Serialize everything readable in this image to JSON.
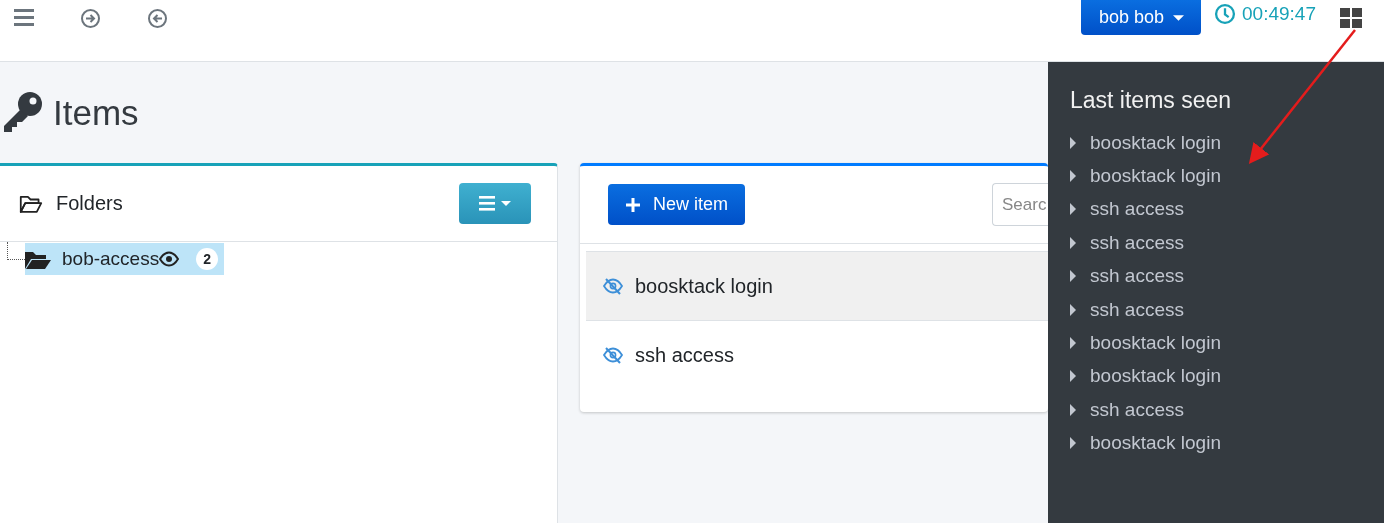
{
  "navbar": {
    "user_button": "bob bob",
    "timer": "00:49:47"
  },
  "page": {
    "title": "Items"
  },
  "folders": {
    "title": "Folders",
    "tree": [
      {
        "label": "bob-access",
        "count": "2",
        "selected": true
      }
    ]
  },
  "items": {
    "new_button": "New item",
    "search": {
      "placeholder": "Searc"
    },
    "rows": [
      {
        "label": "boosktack login",
        "selected": true
      },
      {
        "label": "ssh access",
        "selected": false
      }
    ]
  },
  "sidebar": {
    "title": "Last items seen",
    "items": [
      "boosktack login",
      "boosktack login",
      "ssh access",
      "ssh access",
      "ssh access",
      "ssh access",
      "boosktack login",
      "boosktack login",
      "ssh access",
      "boosktack login"
    ]
  }
}
